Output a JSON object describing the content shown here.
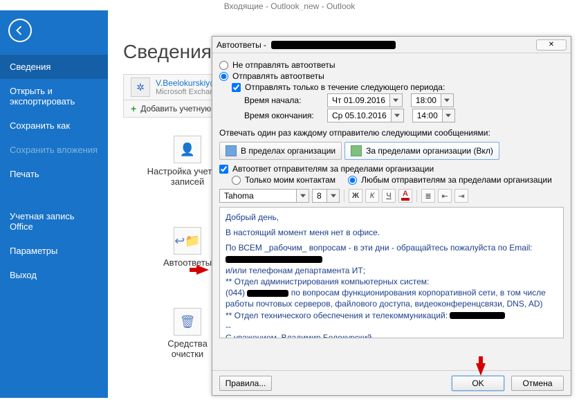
{
  "window_title": "Входящие - Outlook_new - Outlook",
  "sidebar": {
    "items": [
      {
        "label": "Сведения",
        "key": "info",
        "active": true
      },
      {
        "label": "Открыть и экспортировать",
        "key": "open-export"
      },
      {
        "label": "Сохранить как",
        "key": "save-as"
      },
      {
        "label": "Сохранить вложения",
        "key": "save-attach",
        "dim": true
      },
      {
        "label": "Печать",
        "key": "print"
      },
      {
        "label": "Учетная запись Office",
        "key": "office-account",
        "spacer_before": true
      },
      {
        "label": "Параметры",
        "key": "options"
      },
      {
        "label": "Выход",
        "key": "exit"
      }
    ]
  },
  "main": {
    "page_title": "Сведения",
    "account_email": "V.Beelokurskiy@",
    "account_type": "Microsoft Exchange",
    "add_account": "Добавить учетную",
    "tiles": [
      {
        "line1": "Настройка учетных",
        "line2": "записей",
        "key": "accounts"
      },
      {
        "line1": "Автоответы",
        "line2": "",
        "key": "autoreply"
      },
      {
        "line1": "Средства",
        "line2": "очистки",
        "key": "cleanup"
      }
    ]
  },
  "dialog": {
    "title_prefix": "Автоответы - ",
    "radio_off": "Не отправлять автоответы",
    "radio_on": "Отправлять автоответы",
    "chk_period": "Отправлять только в течение следующего периода:",
    "lbl_start": "Время начала:",
    "lbl_end": "Время окончания:",
    "start_date": "Чт 01.09.2016",
    "start_time": "18:00",
    "end_date": "Ср 05.10.2016",
    "end_time": "14:00",
    "reply_once": "Отвечать один раз каждому отправителю следующими сообщениями:",
    "tab_inside": "В пределах организации",
    "tab_outside": "За пределами организации (Вкл)",
    "chk_outside": "Автоответ отправителям за пределами организации",
    "radio_contacts": "Только моим контактам",
    "radio_anyone": "Любым отправителям за пределами организации",
    "font_name": "Tahoma",
    "font_size": "8",
    "fmt": {
      "bold": "Ж",
      "italic": "К",
      "underline": "Ч",
      "a": "А"
    },
    "editor": {
      "l1": "Добрый день,",
      "l2": "В настоящий момент меня нет в офисе.",
      "l3a": "По ВСЕМ _рабочим_ вопросам - в эти дни - обращайтесь пожалуйста по Email:",
      "l4": "и/или телефонам департамента ИТ;",
      "l5": "** Отдел администрирования компьютерных систем:",
      "l6a": "(044)",
      "l6b": "по вопросам функционирования корпоративной сети, в том числе работы почтовых серверов, файлового доступа, видеоконференцсвязи, DNS, AD)",
      "l7": "** Отдел технического обеспечения и телекоммуникаций:",
      "l8": "--",
      "l9": "С уважением, Владимир Белокурский"
    },
    "btn_rules": "Правила...",
    "btn_ok": "OK",
    "btn_cancel": "Отмена"
  }
}
